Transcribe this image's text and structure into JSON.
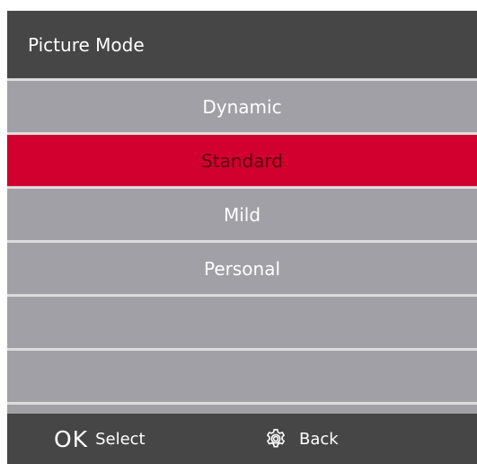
{
  "header": {
    "title": "Picture Mode"
  },
  "menu": {
    "items": [
      {
        "label": "Dynamic"
      },
      {
        "label": "Standard"
      },
      {
        "label": "Mild"
      },
      {
        "label": "Personal"
      },
      {
        "label": ""
      },
      {
        "label": ""
      }
    ],
    "selected": "Standard"
  },
  "footer": {
    "ok_key": "OK",
    "select_label": "Select",
    "back_icon": "gear-icon",
    "back_label": "Back"
  },
  "colors": {
    "header_bg": "#464646",
    "item_bg": "#a0a0a6",
    "selected_bg": "#d1002e",
    "selected_text": "#5a0010",
    "divider": "#dcdcdc"
  }
}
